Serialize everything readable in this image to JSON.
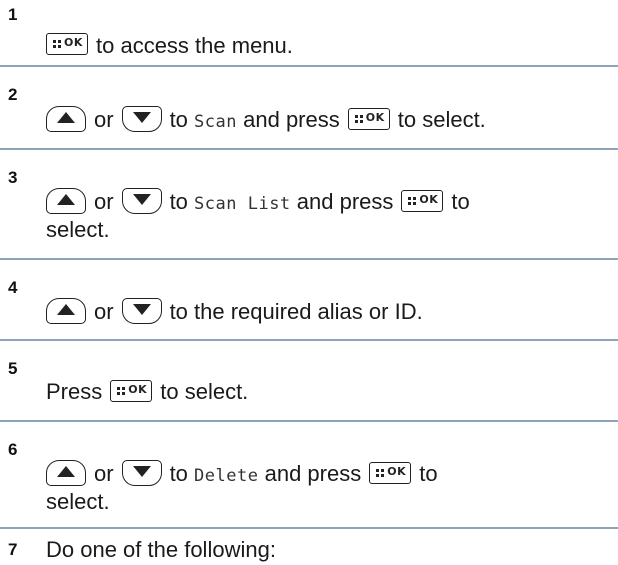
{
  "steps": [
    {
      "number": "1",
      "parts": {
        "t1": "to access the menu."
      }
    },
    {
      "number": "2",
      "parts": {
        "or": "or",
        "t1": "to",
        "mono": "Scan",
        "t2": "and press",
        "t3": "to select."
      }
    },
    {
      "number": "3",
      "parts": {
        "or": "or",
        "t1": "to",
        "mono": "Scan List",
        "t2": "and press",
        "t3": "to",
        "t4": "select."
      }
    },
    {
      "number": "4",
      "parts": {
        "or": "or",
        "t1": "to the required alias or ID."
      }
    },
    {
      "number": "5",
      "parts": {
        "t0": "Press",
        "t1": "to select."
      }
    },
    {
      "number": "6",
      "parts": {
        "or": "or",
        "t1": "to",
        "mono": "Delete",
        "t2": "and press",
        "t3": "to",
        "t4": "select."
      }
    },
    {
      "number": "7",
      "parts": {
        "t1": "Do one of the following:"
      }
    }
  ],
  "keys": {
    "ok_label": "OK"
  },
  "icons": {
    "ok_key": "menu-ok-key-icon",
    "up_key": "up-arrow-key-icon",
    "down_key": "down-arrow-key-icon"
  },
  "colors": {
    "divider": "#8fa3b8",
    "text": "#1a1a1a"
  }
}
